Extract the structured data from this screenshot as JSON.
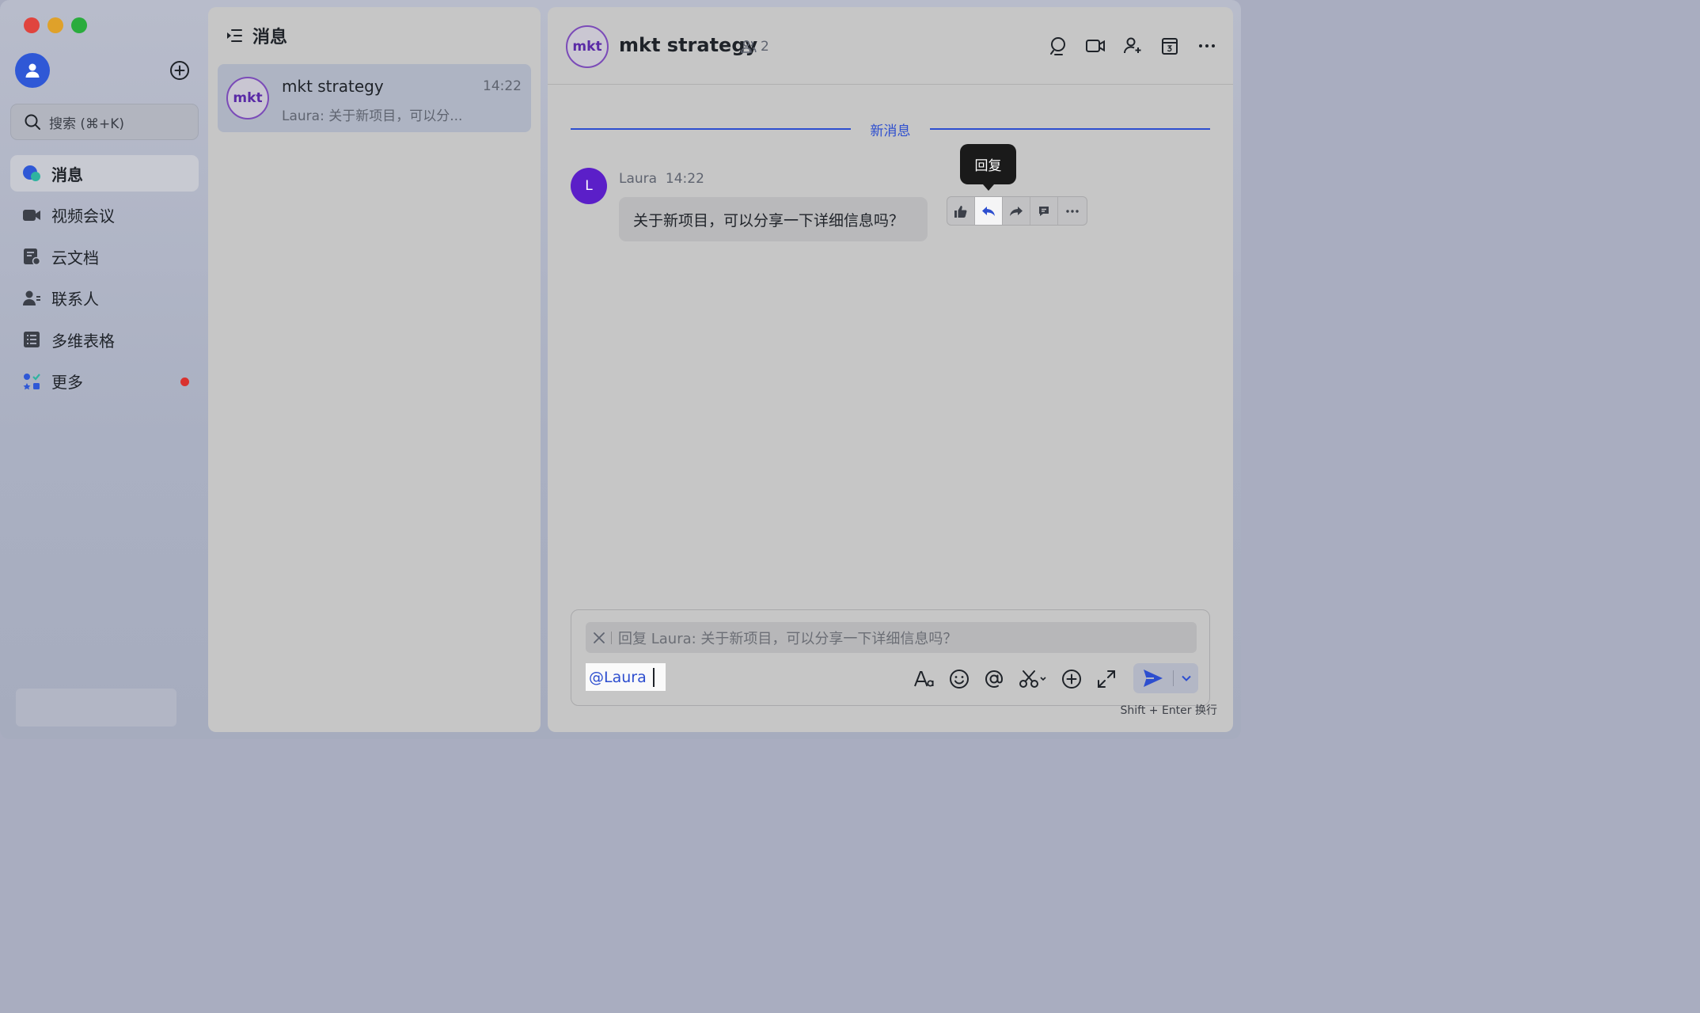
{
  "nav": {
    "search_placeholder": "搜索 (⌘+K)",
    "items": [
      {
        "label": "消息",
        "icon": "chat-bubble-icon",
        "active": true
      },
      {
        "label": "视频会议",
        "icon": "video-camera-icon"
      },
      {
        "label": "云文档",
        "icon": "cloud-doc-icon"
      },
      {
        "label": "联系人",
        "icon": "contacts-icon"
      },
      {
        "label": "多维表格",
        "icon": "table-grid-icon"
      },
      {
        "label": "更多",
        "icon": "more-apps-icon",
        "badge": true
      }
    ]
  },
  "list": {
    "title": "消息",
    "conversations": [
      {
        "avatar": "mkt",
        "name": "mkt strategy",
        "time": "14:22",
        "preview": "Laura: 关于新项目，可以分..."
      }
    ]
  },
  "chat": {
    "avatar": "mkt",
    "title": "mkt strategy",
    "member_count": "2",
    "new_divider": "新消息",
    "message": {
      "avatar": "L",
      "sender": "Laura",
      "time": "14:22",
      "text": "关于新项目，可以分享一下详细信息吗？"
    },
    "tooltip": "回复",
    "composer": {
      "reply_text": "回复 Laura: 关于新项目，可以分享一下详细信息吗？",
      "mention": "@Laura"
    },
    "hint": "Shift + Enter 换行"
  },
  "colors": {
    "accent": "#2d4ecf",
    "group_avatar_border": "#7b4bb8",
    "user_avatar": "#5b1fc8",
    "badge": "#d9322f"
  }
}
